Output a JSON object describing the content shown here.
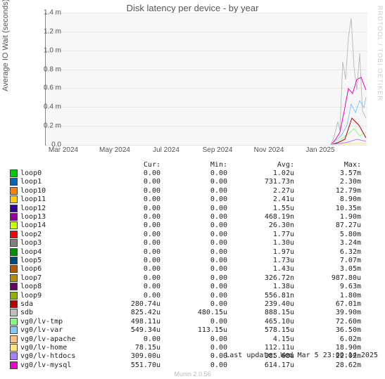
{
  "title": "Disk latency per device - by year",
  "ylabel": "Average IO Wait (seconds)",
  "watermark": "RRDTOOL / TOBI OETIKER",
  "munin_version": "Munin 2.0.56",
  "last_update": "Last update: Wed Mar  5 23:00:14 2025",
  "headers": {
    "cur": "Cur:",
    "min": "Min:",
    "avg": "Avg:",
    "max": "Max:"
  },
  "chart_data": {
    "type": "line",
    "xlabel": "",
    "ylabel": "Average IO Wait (seconds)",
    "ylim": [
      0,
      0.0015
    ],
    "yticks": [
      "0.0",
      "0.2 m",
      "0.4 m",
      "0.6 m",
      "0.8 m",
      "1.0 m",
      "1.2 m",
      "1.4 m"
    ],
    "xticks": [
      "Mar 2024",
      "May 2024",
      "Jul 2024",
      "Sep 2024",
      "Nov 2024",
      "Jan 2025"
    ],
    "series": [
      {
        "name": "loop0",
        "color": "#00cc00",
        "cur": "0.00",
        "min": "0.00",
        "avg": "1.02u",
        "max": "3.57m"
      },
      {
        "name": "loop1",
        "color": "#0066b3",
        "cur": "0.00",
        "min": "0.00",
        "avg": "731.73n",
        "max": "2.30m"
      },
      {
        "name": "loop10",
        "color": "#ff8000",
        "cur": "0.00",
        "min": "0.00",
        "avg": "2.27u",
        "max": "12.79m"
      },
      {
        "name": "loop11",
        "color": "#ffcc00",
        "cur": "0.00",
        "min": "0.00",
        "avg": "2.41u",
        "max": "8.90m"
      },
      {
        "name": "loop12",
        "color": "#330099",
        "cur": "0.00",
        "min": "0.00",
        "avg": "1.55u",
        "max": "10.35m"
      },
      {
        "name": "loop13",
        "color": "#990099",
        "cur": "0.00",
        "min": "0.00",
        "avg": "468.19n",
        "max": "1.90m"
      },
      {
        "name": "loop14",
        "color": "#ccff00",
        "cur": "0.00",
        "min": "0.00",
        "avg": "26.30n",
        "max": "87.27u"
      },
      {
        "name": "loop2",
        "color": "#ff0000",
        "cur": "0.00",
        "min": "0.00",
        "avg": "1.77u",
        "max": "5.80m"
      },
      {
        "name": "loop3",
        "color": "#808080",
        "cur": "0.00",
        "min": "0.00",
        "avg": "1.30u",
        "max": "3.24m"
      },
      {
        "name": "loop4",
        "color": "#008f00",
        "cur": "0.00",
        "min": "0.00",
        "avg": "1.97u",
        "max": "6.32m"
      },
      {
        "name": "loop5",
        "color": "#00487d",
        "cur": "0.00",
        "min": "0.00",
        "avg": "1.73u",
        "max": "7.07m"
      },
      {
        "name": "loop6",
        "color": "#b35a00",
        "cur": "0.00",
        "min": "0.00",
        "avg": "1.43u",
        "max": "3.05m"
      },
      {
        "name": "loop7",
        "color": "#b38f00",
        "cur": "0.00",
        "min": "0.00",
        "avg": "326.72n",
        "max": "987.80u"
      },
      {
        "name": "loop8",
        "color": "#6b006b",
        "cur": "0.00",
        "min": "0.00",
        "avg": "1.38u",
        "max": "9.63m"
      },
      {
        "name": "loop9",
        "color": "#8fb300",
        "cur": "0.00",
        "min": "0.00",
        "avg": "556.81n",
        "max": "1.80m"
      },
      {
        "name": "sda",
        "color": "#b30000",
        "cur": "280.74u",
        "min": "0.00",
        "avg": "239.40u",
        "max": "67.01m"
      },
      {
        "name": "sdb",
        "color": "#bebebe",
        "cur": "825.42u",
        "min": "480.15u",
        "avg": "888.15u",
        "max": "39.90m"
      },
      {
        "name": "vg0/lv-tmp",
        "color": "#80ff80",
        "cur": "498.11u",
        "min": "0.00",
        "avg": "465.10u",
        "max": "72.60m"
      },
      {
        "name": "vg0/lv-var",
        "color": "#80c9ff",
        "cur": "549.34u",
        "min": "113.15u",
        "avg": "578.15u",
        "max": "36.50m"
      },
      {
        "name": "vg0/lv-apache",
        "color": "#ffc080",
        "cur": "0.00",
        "min": "0.00",
        "avg": "4.15u",
        "max": "6.02m"
      },
      {
        "name": "vg0/lv-home",
        "color": "#ffe680",
        "cur": "78.15u",
        "min": "0.00",
        "avg": "112.11u",
        "max": "18.90m"
      },
      {
        "name": "vg0/lv-htdocs",
        "color": "#aa80ff",
        "cur": "309.00u",
        "min": "0.00",
        "avg": "385.68u",
        "max": "22.02m"
      },
      {
        "name": "vg0/lv-mysql",
        "color": "#ee00cc",
        "cur": "551.70u",
        "min": "0.00",
        "avg": "614.17u",
        "max": "28.62m"
      }
    ]
  }
}
